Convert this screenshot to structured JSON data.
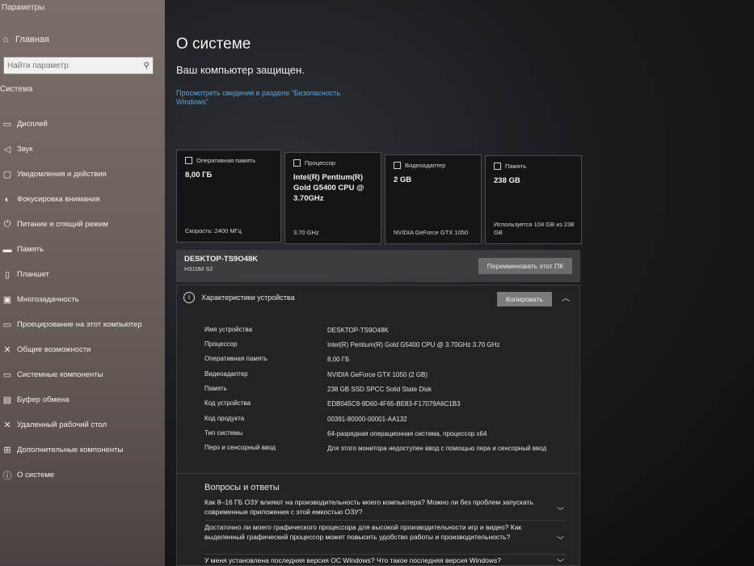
{
  "window": {
    "title": "Параметры"
  },
  "sidebar": {
    "home_label": "Главная",
    "search_placeholder": "Найти параметр",
    "section_label": "Система",
    "items": [
      {
        "label": "Дисплей",
        "icon": "display-icon"
      },
      {
        "label": "Звук",
        "icon": "sound-icon"
      },
      {
        "label": "Уведомления и действия",
        "icon": "notification-icon"
      },
      {
        "label": "Фокусировка внимания",
        "icon": "focus-icon"
      },
      {
        "label": "Питание и спящий режим",
        "icon": "power-icon"
      },
      {
        "label": "Память",
        "icon": "storage-icon"
      },
      {
        "label": "Планшет",
        "icon": "tablet-icon"
      },
      {
        "label": "Многозадачность",
        "icon": "multitask-icon"
      },
      {
        "label": "Проецирование на этот компьютер",
        "icon": "projection-icon"
      },
      {
        "label": "Общие возможности",
        "icon": "shared-icon"
      },
      {
        "label": "Системные компоненты",
        "icon": "components-icon"
      },
      {
        "label": "Буфер обмена",
        "icon": "clipboard-icon"
      },
      {
        "label": "Удаленный рабочий стол",
        "icon": "remote-desktop-icon"
      },
      {
        "label": "Дополнительные компоненты",
        "icon": "extra-components-icon"
      },
      {
        "label": "О системе",
        "icon": "about-icon"
      }
    ]
  },
  "main": {
    "title": "О системе",
    "protected_text": "Ваш компьютер защищен.",
    "security_link": "Просмотреть сведения в разделе \"Безопасность Windows\"",
    "cards": [
      {
        "head": "Оперативная память",
        "value": "8,00 ГБ",
        "foot": "Скорость: 2400 МГц"
      },
      {
        "head": "Процессор",
        "value": "Intel(R) Pentium(R) Gold G5400 CPU @ 3.70GHz",
        "foot": "3.70 GHz"
      },
      {
        "head": "Видеоадаптер",
        "value": "2 GB",
        "foot": "NVIDIA GeForce GTX 1050"
      },
      {
        "head": "Память",
        "value": "238 GB",
        "foot": "Используется 104 GB из 238 GB"
      }
    ],
    "device": {
      "name": "DESKTOP-TS9O48K",
      "model": "H310M S2",
      "rename_label": "Переименовать этот ПК"
    },
    "specs": {
      "title": "Характеристики устройства",
      "copy_label": "Копировать",
      "rows": [
        {
          "label": "Имя устройства",
          "value": "DESKTOP-TS9O48K"
        },
        {
          "label": "Процессор",
          "value": "Intel(R) Pentium(R) Gold G5400 CPU @ 3.70GHz   3.70 GHz"
        },
        {
          "label": "Оперативная память",
          "value": "8,00 ГБ"
        },
        {
          "label": "Видеоадаптер",
          "value": "NVIDIA GeForce GTX 1050 (2 GB)"
        },
        {
          "label": "Память",
          "value": "238 GB SSD SPCC Solid State Disk"
        },
        {
          "label": "Код устройства",
          "value": "EDB045C9-9D60-4F65-BE83-F17079A6C1B3"
        },
        {
          "label": "Код продукта",
          "value": "00391-80000-00001-AA132"
        },
        {
          "label": "Тип системы",
          "value": "64-разрядная операционная система, процессор x64"
        },
        {
          "label": "Перо и сенсорный ввод",
          "value": "Для этого монитора недоступен ввод с помощью пера и сенсорный ввод"
        }
      ]
    },
    "faq": {
      "title": "Вопросы и ответы",
      "items": [
        "Как 8–16 ГБ ОЗУ влияют на производительность моего компьютера? Можно ли без проблем запускать современные приложения с этой емкостью ОЗУ?",
        "Достаточно ли моего графического процессора для высокой производительности игр и видео? Как выделенный графический процессор может повысить удобство работы и производительность?",
        "У меня установлена последняя версия ОС Windows? Что такое последняя версия Windows?"
      ]
    }
  }
}
